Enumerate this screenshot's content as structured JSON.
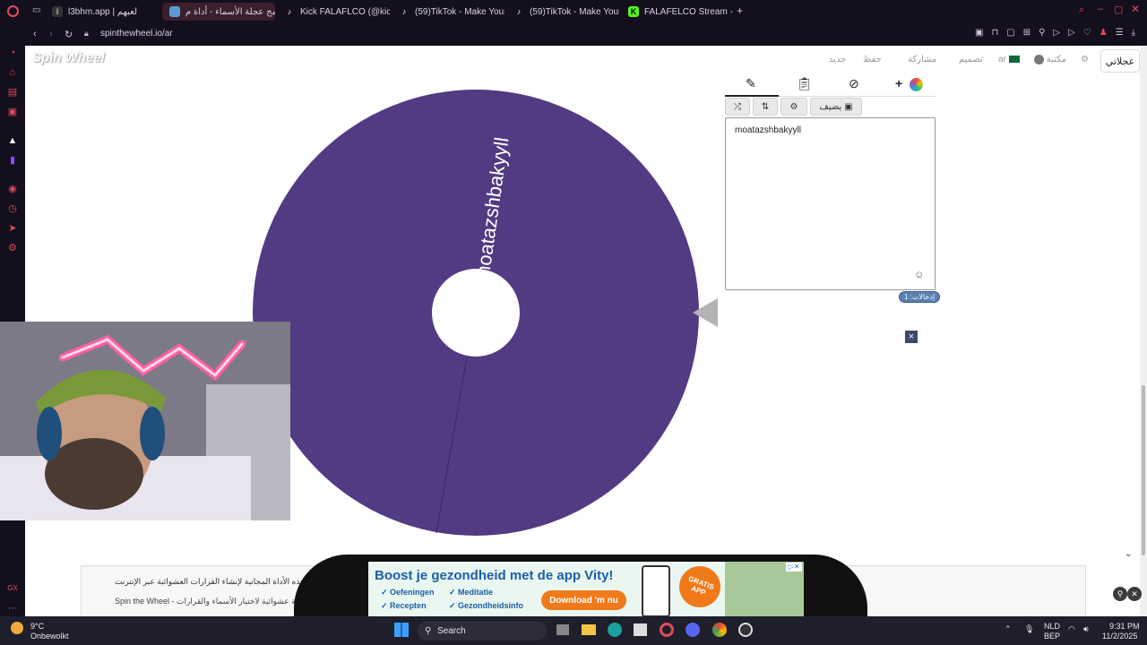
{
  "browser": {
    "tabs": [
      {
        "label": "l3bhm.app | لعبهم",
        "active": false
      },
      {
        "label": "برنامج عجلة الأسماء - أداة م...",
        "active": true
      },
      {
        "label": "Kick FALAFLCO (@kick_f...",
        "active": false
      },
      {
        "label": "(59)TikTok - Make Your D...",
        "active": false
      },
      {
        "label": "(59)TikTok - Make Your D...",
        "active": false
      },
      {
        "label": "FALAFELCO Stream - Wat...",
        "active": false
      }
    ],
    "new_tab": "+",
    "url": "spinthewheel.io/ar"
  },
  "site": {
    "logo": "Spin Wheel",
    "nav": {
      "my_wheels": "عجلاتي",
      "gallery": "مكتبة",
      "lang": "ar",
      "design": "تصميم",
      "share": "مشاركة",
      "save": "حفظ",
      "new": "جديد"
    }
  },
  "editor": {
    "add_image_button": "يضيف",
    "entries_text": "moatazshbakyyll",
    "entries_count": "إدخالات: 1",
    "close_ad": "×"
  },
  "wheel": {
    "segments": [
      "moatazshbakyyll"
    ],
    "color": "#533b83",
    "pointer_color": "#b3b3b3"
  },
  "page_text": {
    "line1": "تعرف على هذه الأداة المجانية لإنشاء القرارات العشوائية عبر الإنترنت",
    "line2": "Spin the Wheel - عجلة عشوائية لاختيار الأسماء والقرارات"
  },
  "ad": {
    "title": "Boost je gezondheid met de app Vity!",
    "bullets": [
      "Oefeningen",
      "Meditatie",
      "Recepten",
      "Gezondheidsinfo"
    ],
    "cta": "Download 'm nu",
    "badge": "GRATIS APP"
  },
  "taskbar": {
    "weather_temp": "9°C",
    "weather_desc": "Onbewolkt",
    "search": "Search",
    "lang1": "NLD",
    "lang2": "BEP",
    "time": "9:31 PM",
    "date": "11/2/2025"
  },
  "colors": {
    "accent": "#e04a5a",
    "wheel": "#533b83"
  }
}
